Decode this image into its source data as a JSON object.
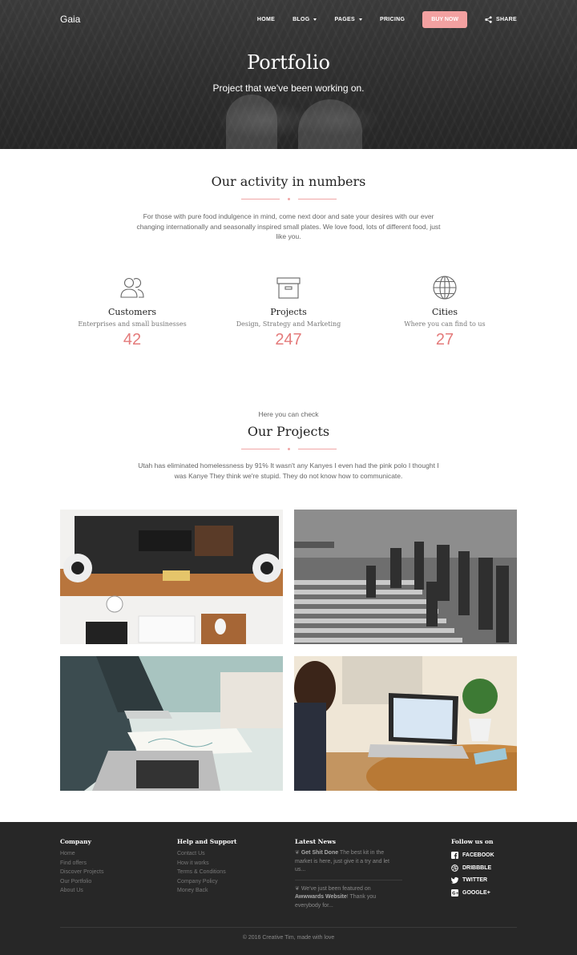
{
  "nav": {
    "brand": "Gaia",
    "home": "HOME",
    "blog": "BLOG",
    "pages": "PAGES",
    "pricing": "PRICING",
    "buy_now": "BUY NOW",
    "share": "SHARE"
  },
  "hero": {
    "title": "Portfolio",
    "subtitle": "Project that we've been working on."
  },
  "activity": {
    "title": "Our activity in numbers",
    "text": "For those with pure food indulgence in mind, come next door and sate your desires with our ever changing internationally and seasonally inspired small plates. We love food, lots of different food, just like you.",
    "stats": [
      {
        "name": "Customers",
        "desc": "Enterprises and small businesses",
        "value": "42",
        "icon": "users-icon"
      },
      {
        "name": "Projects",
        "desc": "Design, Strategy and Marketing",
        "value": "247",
        "icon": "archive-box-icon"
      },
      {
        "name": "Cities",
        "desc": "Where you can find to us",
        "value": "27",
        "icon": "globe-icon"
      }
    ]
  },
  "projects": {
    "pretitle": "Here you can check",
    "title": "Our Projects",
    "text": "Utah has eliminated homelessness by 91% It wasn't any Kanyes I even had the pink polo I thought I was Kanye They think we're stupid. They do not know how to communicate."
  },
  "footer": {
    "company": {
      "title": "Company",
      "links": [
        "Home",
        "Find offers",
        "Discover Projects",
        "Our Portfolio",
        "About Us"
      ]
    },
    "help": {
      "title": "Help and Support",
      "links": [
        "Contact Us",
        "How it works",
        "Terms & Conditions",
        "Company Policy",
        "Money Back"
      ]
    },
    "news": {
      "title": "Latest News",
      "items": [
        {
          "bold": "Get Shit Done",
          "text": " The best kit in the market is here, just give it a try and let us..."
        },
        {
          "pre": "We've just been featured on ",
          "bold": "Awwwards Website",
          "text": "! Thank you everybody for..."
        }
      ]
    },
    "follow": {
      "title": "Follow us on",
      "items": [
        "FACEBOOK",
        "DRIBBBLE",
        "TWITTER",
        "GOOGLE+"
      ]
    },
    "copyright": "© 2016 Creative Tim, made with love"
  },
  "colors": {
    "accent": "#e47b7b",
    "button": "#f3a1a1",
    "footer_bg": "#272727"
  }
}
